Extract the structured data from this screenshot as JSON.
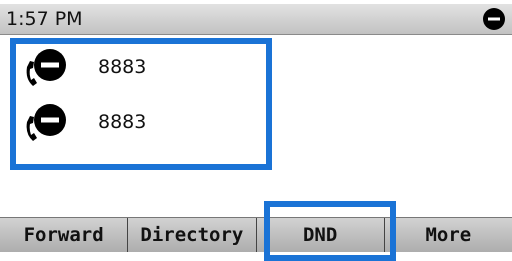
{
  "statusbar": {
    "time": "1:57 PM",
    "icon": "dnd-icon"
  },
  "lines": [
    {
      "number": "8883",
      "icon": "dnd-phone-icon"
    },
    {
      "number": "8883",
      "icon": "dnd-phone-icon"
    }
  ],
  "softkeys": [
    {
      "label": "Forward"
    },
    {
      "label": "Directory"
    },
    {
      "label": "DND"
    },
    {
      "label": "More"
    }
  ],
  "colors": {
    "highlight": "#1a73d6",
    "status_bg": "#cfcfcf",
    "softkey_bg": "#bebebe"
  }
}
